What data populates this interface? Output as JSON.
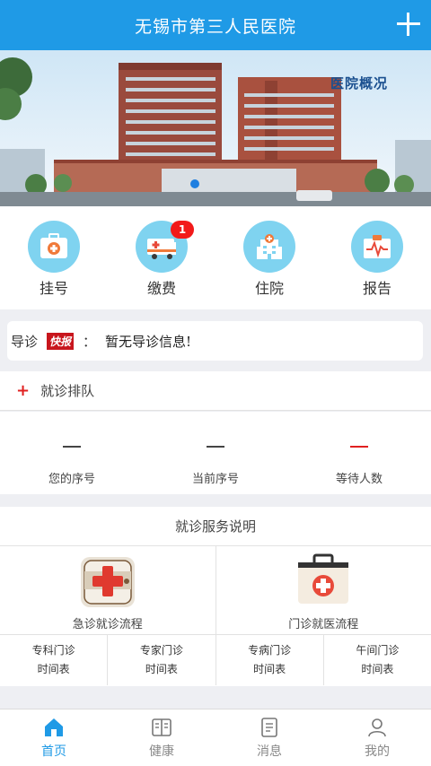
{
  "header": {
    "title": "无锡市第三人民医院",
    "add_icon": "plus-icon"
  },
  "banner": {
    "caption": "医院概况"
  },
  "quick_actions": [
    {
      "label": "挂号",
      "icon": "registration-icon"
    },
    {
      "label": "缴费",
      "icon": "payment-icon",
      "badge": "1"
    },
    {
      "label": "住院",
      "icon": "hospital-icon"
    },
    {
      "label": "报告",
      "icon": "report-icon"
    }
  ],
  "guide": {
    "label": "导诊",
    "flash": "快报",
    "colon": "：",
    "message": "暂无导诊信息!"
  },
  "queue": {
    "title": "就诊排队",
    "cells": [
      {
        "value": "—",
        "label": "您的序号"
      },
      {
        "value": "—",
        "label": "当前序号"
      },
      {
        "value": "—",
        "label": "等待人数"
      }
    ]
  },
  "service": {
    "title": "就诊服务说明",
    "flows": [
      {
        "label": "急诊就诊流程",
        "icon": "emergency-kit-icon"
      },
      {
        "label": "门诊就医流程",
        "icon": "medical-case-icon"
      }
    ],
    "schedules": [
      {
        "line1": "专科门诊",
        "line2": "时间表"
      },
      {
        "line1": "专家门诊",
        "line2": "时间表"
      },
      {
        "line1": "专病门诊",
        "line2": "时间表"
      },
      {
        "line1": "午间门诊",
        "line2": "时间表"
      }
    ]
  },
  "tabs": [
    {
      "label": "首页",
      "icon": "home-icon",
      "active": true
    },
    {
      "label": "健康",
      "icon": "book-icon"
    },
    {
      "label": "消息",
      "icon": "message-icon"
    },
    {
      "label": "我的",
      "icon": "user-icon"
    }
  ],
  "colors": {
    "primary": "#1f9ae6",
    "accent_red": "#e02020",
    "icon_bg": "#7fd3f0"
  }
}
